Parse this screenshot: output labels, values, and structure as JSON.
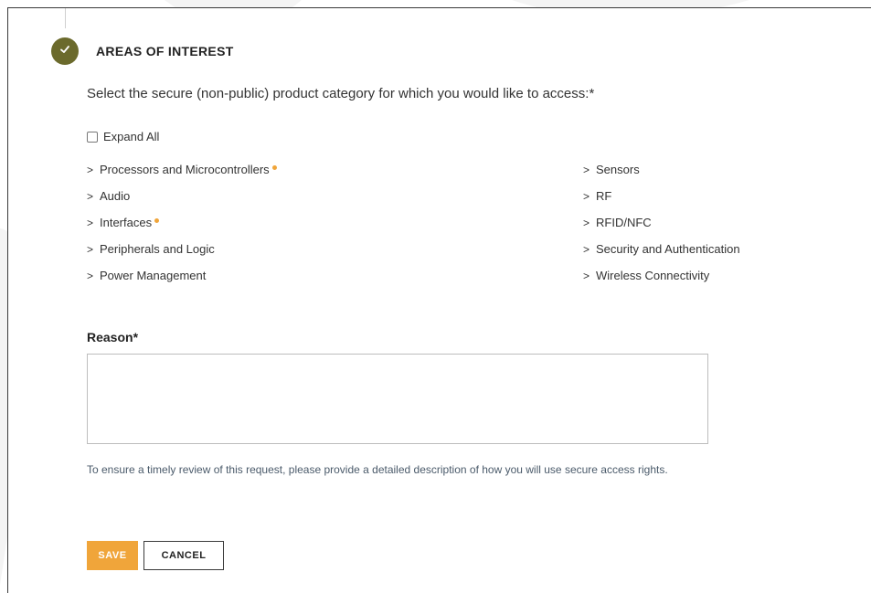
{
  "section": {
    "title": "AREAS OF INTEREST",
    "prompt": "Select the secure (non-public) product category for which you would like to access:*",
    "expand_all_label": "Expand All"
  },
  "categories": {
    "left": [
      {
        "label": "Processors and Microcontrollers",
        "marked": true
      },
      {
        "label": "Audio",
        "marked": false
      },
      {
        "label": "Interfaces",
        "marked": true
      },
      {
        "label": "Peripherals and Logic",
        "marked": false
      },
      {
        "label": "Power Management",
        "marked": false
      }
    ],
    "right": [
      {
        "label": "Sensors",
        "marked": false
      },
      {
        "label": "RF",
        "marked": false
      },
      {
        "label": "RFID/NFC",
        "marked": false
      },
      {
        "label": "Security and Authentication",
        "marked": false
      },
      {
        "label": "Wireless Connectivity",
        "marked": false
      }
    ]
  },
  "reason": {
    "label": "Reason*",
    "value": "",
    "help_text": "To ensure a timely review of this request, please provide a detailed description of how you will use secure access rights."
  },
  "actions": {
    "save_label": "SAVE",
    "cancel_label": "CANCEL"
  },
  "colors": {
    "step_badge": "#6b6a2c",
    "accent": "#f0a53a",
    "help_text": "#4a5a6a"
  },
  "icons": {
    "step": "checkmark-icon",
    "category_toggle": "chevron-right-icon",
    "marker": "dot-icon"
  }
}
